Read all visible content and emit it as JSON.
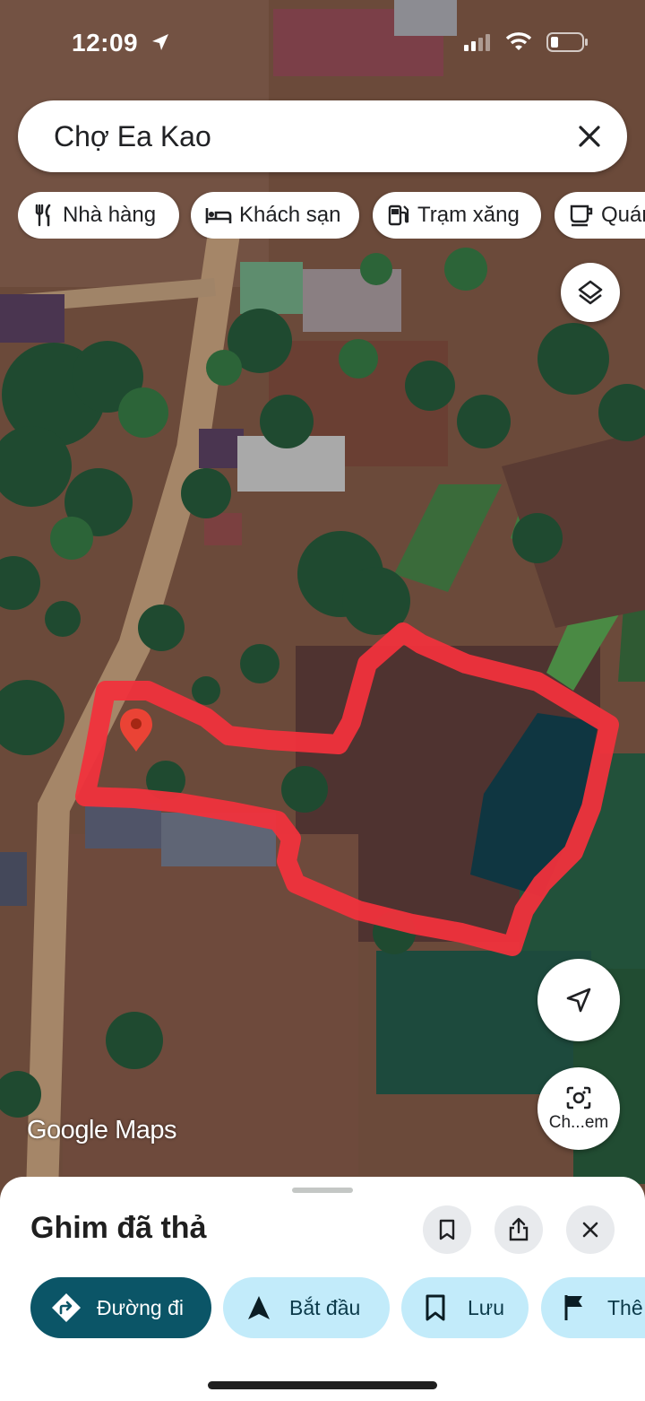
{
  "status_bar": {
    "time": "12:09"
  },
  "search": {
    "query": "Chợ Ea Kao"
  },
  "chips": [
    {
      "label": "Nhà hàng",
      "icon": "fork-knife-icon"
    },
    {
      "label": "Khách sạn",
      "icon": "bed-icon"
    },
    {
      "label": "Trạm xăng",
      "icon": "gas-station-icon"
    },
    {
      "label": "Quán",
      "icon": "coffee-cup-icon"
    }
  ],
  "map": {
    "watermark": "Google Maps",
    "marker": "red-pin-icon",
    "boundary_color": "#f0323c"
  },
  "fabs": {
    "layers": "layers-icon",
    "my_location": "navigation-arrow-icon",
    "lens_label": "Ch...em"
  },
  "sheet": {
    "title": "Ghim đã thả",
    "actions": [
      {
        "label": "Đường đi",
        "icon": "directions-icon",
        "style": "primary"
      },
      {
        "label": "Bắt đầu",
        "icon": "navigation-icon",
        "style": "secondary"
      },
      {
        "label": "Lưu",
        "icon": "bookmark-icon",
        "style": "secondary"
      },
      {
        "label": "Thê",
        "icon": "flag-icon",
        "style": "secondary"
      }
    ]
  },
  "colors": {
    "primary_button": "#0b5567",
    "secondary_button": "#c2ebfa"
  }
}
